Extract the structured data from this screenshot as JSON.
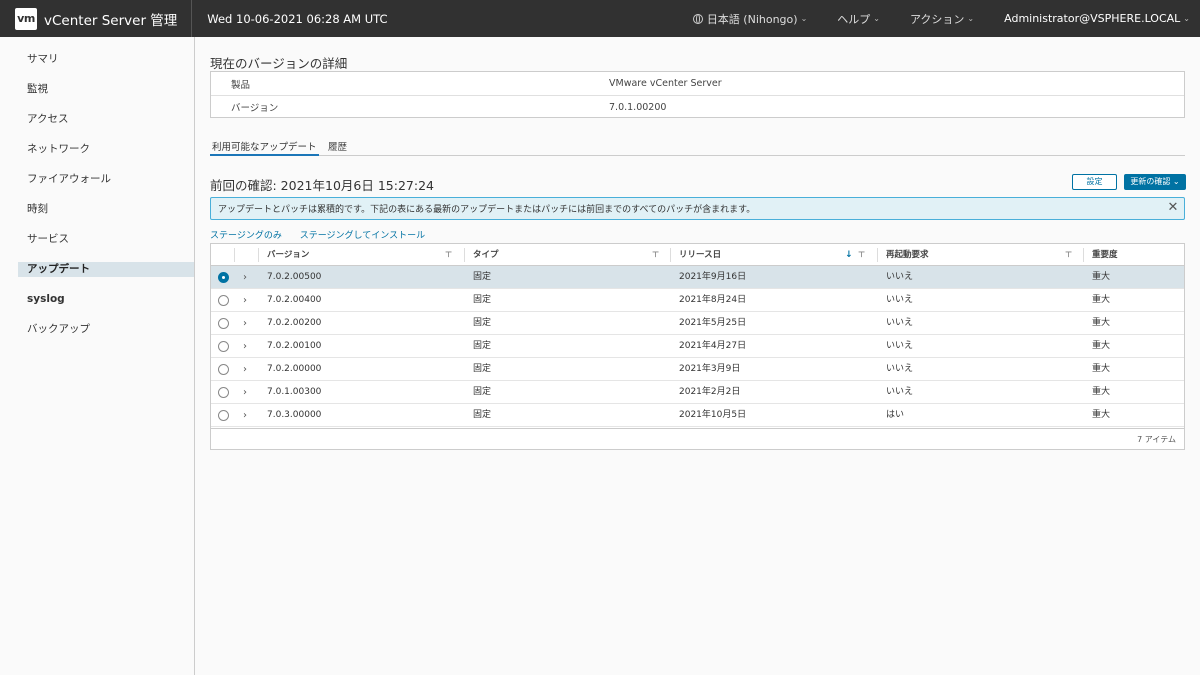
{
  "header": {
    "logo_text": "vm",
    "app_title": "vCenter Server 管理",
    "date": "Wed 10-06-2021 06:28 AM UTC",
    "language": "日本語 (Nihongo)",
    "help": "ヘルプ",
    "actions": "アクション",
    "user": "Administrator@VSPHERE.LOCAL"
  },
  "sidebar": {
    "items": [
      {
        "label": "サマリ"
      },
      {
        "label": "監視"
      },
      {
        "label": "アクセス"
      },
      {
        "label": "ネットワーク"
      },
      {
        "label": "ファイアウォール"
      },
      {
        "label": "時刻"
      },
      {
        "label": "サービス"
      },
      {
        "label": "アップデート"
      },
      {
        "label": "syslog"
      },
      {
        "label": "バックアップ"
      }
    ],
    "active_index": 7
  },
  "version_details": {
    "title": "現在のバージョンの詳細",
    "rows": [
      {
        "key": "製品",
        "value": "VMware vCenter Server"
      },
      {
        "key": "バージョン",
        "value": "7.0.1.00200"
      }
    ]
  },
  "tabs": [
    {
      "label": "利用可能なアップデート",
      "active": true
    },
    {
      "label": "履歴",
      "active": false
    }
  ],
  "last_check": "前回の確認: 2021年10月6日 15:27:24",
  "buttons": {
    "settings": "設定",
    "check_updates": "更新の確認"
  },
  "alert": {
    "text": "アップデートとパッチは累積的です。下記の表にある最新のアップデートまたはパッチには前回までのすべてのパッチが含まれます。"
  },
  "links": {
    "stage_only": "ステージングのみ",
    "stage_install": "ステージングしてインストール"
  },
  "table": {
    "columns": [
      "バージョン",
      "タイプ",
      "リリース日",
      "再起動要求",
      "重要度"
    ],
    "rows": [
      {
        "version": "7.0.2.00500",
        "type": "固定",
        "release": "2021年9月16日",
        "reboot": "いいえ",
        "severity": "重大",
        "selected": true
      },
      {
        "version": "7.0.2.00400",
        "type": "固定",
        "release": "2021年8月24日",
        "reboot": "いいえ",
        "severity": "重大",
        "selected": false
      },
      {
        "version": "7.0.2.00200",
        "type": "固定",
        "release": "2021年5月25日",
        "reboot": "いいえ",
        "severity": "重大",
        "selected": false
      },
      {
        "version": "7.0.2.00100",
        "type": "固定",
        "release": "2021年4月27日",
        "reboot": "いいえ",
        "severity": "重大",
        "selected": false
      },
      {
        "version": "7.0.2.00000",
        "type": "固定",
        "release": "2021年3月9日",
        "reboot": "いいえ",
        "severity": "重大",
        "selected": false
      },
      {
        "version": "7.0.1.00300",
        "type": "固定",
        "release": "2021年2月2日",
        "reboot": "いいえ",
        "severity": "重大",
        "selected": false
      },
      {
        "version": "7.0.3.00000",
        "type": "固定",
        "release": "2021年10月5日",
        "reboot": "はい",
        "severity": "重大",
        "selected": false
      }
    ],
    "footer": "7 アイテム"
  },
  "colors": {
    "header_bg": "#313131",
    "accent": "#0072a3",
    "selected_row": "#d8e3e9",
    "alert_bg": "#e1f1f6"
  }
}
